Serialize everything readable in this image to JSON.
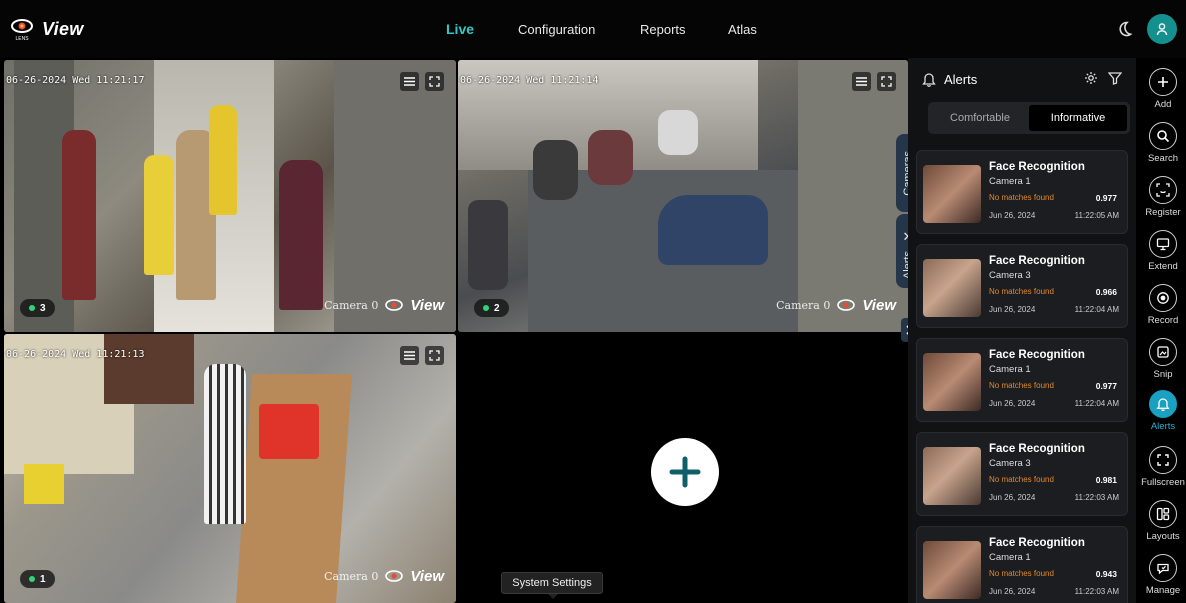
{
  "app": {
    "brand_small": "LENS",
    "brand": "View"
  },
  "nav": {
    "live": "Live",
    "configuration": "Configuration",
    "reports": "Reports",
    "atlas": "Atlas"
  },
  "header_icons": [
    "moon-icon",
    "user-icon"
  ],
  "cameras": [
    {
      "timestamp": "06-26-2024 Wed 11:21:17",
      "badge": "3",
      "watermark": "Camera 0"
    },
    {
      "timestamp": "06-26-2024 Wed 11:21:14",
      "badge": "2",
      "watermark": "Camera 0"
    },
    {
      "timestamp": "06-26-2024 Wed 11:21:13",
      "badge": "1",
      "watermark": "Camera 0"
    }
  ],
  "system_settings": "System Settings",
  "side_tabs": {
    "cameras": "Cameras",
    "alerts": "Alerts",
    "close": "✕"
  },
  "alerts_panel": {
    "title": "Alerts",
    "view_modes": [
      "Comfortable",
      "Informative"
    ],
    "active_view": "Informative",
    "items": [
      {
        "type": "Face Recognition",
        "camera": "Camera 1",
        "status": "No matches found",
        "score": "0.977",
        "date": "Jun 26, 2024",
        "time": "11:22:05 AM"
      },
      {
        "type": "Face Recognition",
        "camera": "Camera 3",
        "status": "No matches found",
        "score": "0.966",
        "date": "Jun 26, 2024",
        "time": "11:22:04 AM"
      },
      {
        "type": "Face Recognition",
        "camera": "Camera 1",
        "status": "No matches found",
        "score": "0.977",
        "date": "Jun 26, 2024",
        "time": "11:22:04 AM"
      },
      {
        "type": "Face Recognition",
        "camera": "Camera 3",
        "status": "No matches found",
        "score": "0.981",
        "date": "Jun 26, 2024",
        "time": "11:22:03 AM"
      },
      {
        "type": "Face Recognition",
        "camera": "Camera 1",
        "status": "No matches found",
        "score": "0.943",
        "date": "Jun 26, 2024",
        "time": "11:22:03 AM"
      }
    ]
  },
  "toolbar": {
    "add": "Add",
    "search": "Search",
    "register": "Register",
    "extend": "Extend",
    "record": "Record",
    "snip": "Snip",
    "alerts": "Alerts",
    "fullscreen": "Fullscreen",
    "layouts": "Layouts",
    "manage": "Manage"
  },
  "colors": {
    "accent": "#32c8c8",
    "active_tool": "#1aa0c0",
    "warning_text": "#e0892b",
    "live_dot": "#2ed67a"
  }
}
